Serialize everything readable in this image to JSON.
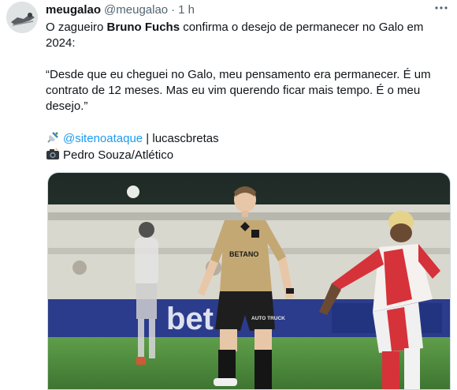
{
  "tweet": {
    "display_name": "meugalao",
    "handle": "@meugalao",
    "separator": "·",
    "time": "1 h",
    "more_icon": "more-horizontal-icon",
    "text": {
      "line1_pre": "O zagueiro ",
      "line1_bold": "Bruno Fuchs",
      "line1_post": " confirma o desejo de permanecer no Galo em 2024:",
      "quote": "“Desde que eu cheguei no Galo, meu pensamento era permanecer. É um contrato de 12 meses. Mas eu vim querendo ficar mais tempo. É o meu desejo.”",
      "credit_link": "@sitenoataque",
      "credit_rest": " | lucascbretas",
      "photo_credit": "Pedro Souza/Atlético"
    },
    "media": {
      "jersey_sponsor": "BETANO",
      "shorts_sponsor": "AUTO TRUCK",
      "board_text": "bet"
    }
  },
  "colors": {
    "link": "#1d9bf0",
    "muted": "#536471",
    "text": "#0f1419",
    "jersey_gold": "#c4a873",
    "pitch": "#4f8f3e"
  }
}
